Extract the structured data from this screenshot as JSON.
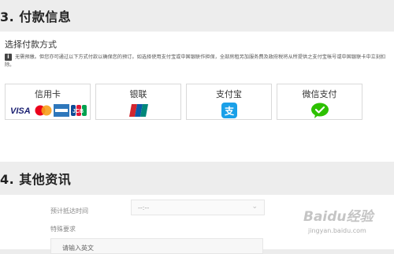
{
  "section3": {
    "title": "3. 付款信息",
    "choose_label": "选择付款方式",
    "notice": "无需预缴。但您亦可通过以下方式付款以确保您的预订。如选择使用支付宝或中国银联作担保，全部房租另加服务费及政府税将从所提供之支付宝帐号或中国银联卡中立刻扣除。",
    "methods": [
      {
        "label": "信用卡",
        "logos": [
          "visa-logo",
          "mastercard-logo",
          "amex-logo",
          "jcb-logo"
        ]
      },
      {
        "label": "银联",
        "logos": [
          "unionpay-logo"
        ]
      },
      {
        "label": "支付宝",
        "logos": [
          "alipay-logo"
        ]
      },
      {
        "label": "微信支付",
        "logos": [
          "wechat-pay-logo"
        ]
      }
    ],
    "visa_text": "VISA",
    "jcb_text": "JCB",
    "alipay_char": "支"
  },
  "section4": {
    "title": "4. 其他资讯",
    "eta_label": "预计抵达时间",
    "eta_value": "--:--",
    "special_label": "特殊要求",
    "special_placeholder": "请输入英文"
  },
  "watermark": {
    "text": "Baidu经验",
    "url": "jingyan.baidu.com"
  },
  "colors": {
    "visa": "#1a1f71",
    "mastercard_red": "#eb001b",
    "mastercard_yellow": "#f79e1b",
    "amex": "#2e77bb",
    "unionpay_red": "#d3252f",
    "unionpay_blue": "#0a5ba9",
    "unionpay_teal": "#00887a",
    "alipay": "#1aa0e8",
    "wechat": "#2dc100"
  }
}
